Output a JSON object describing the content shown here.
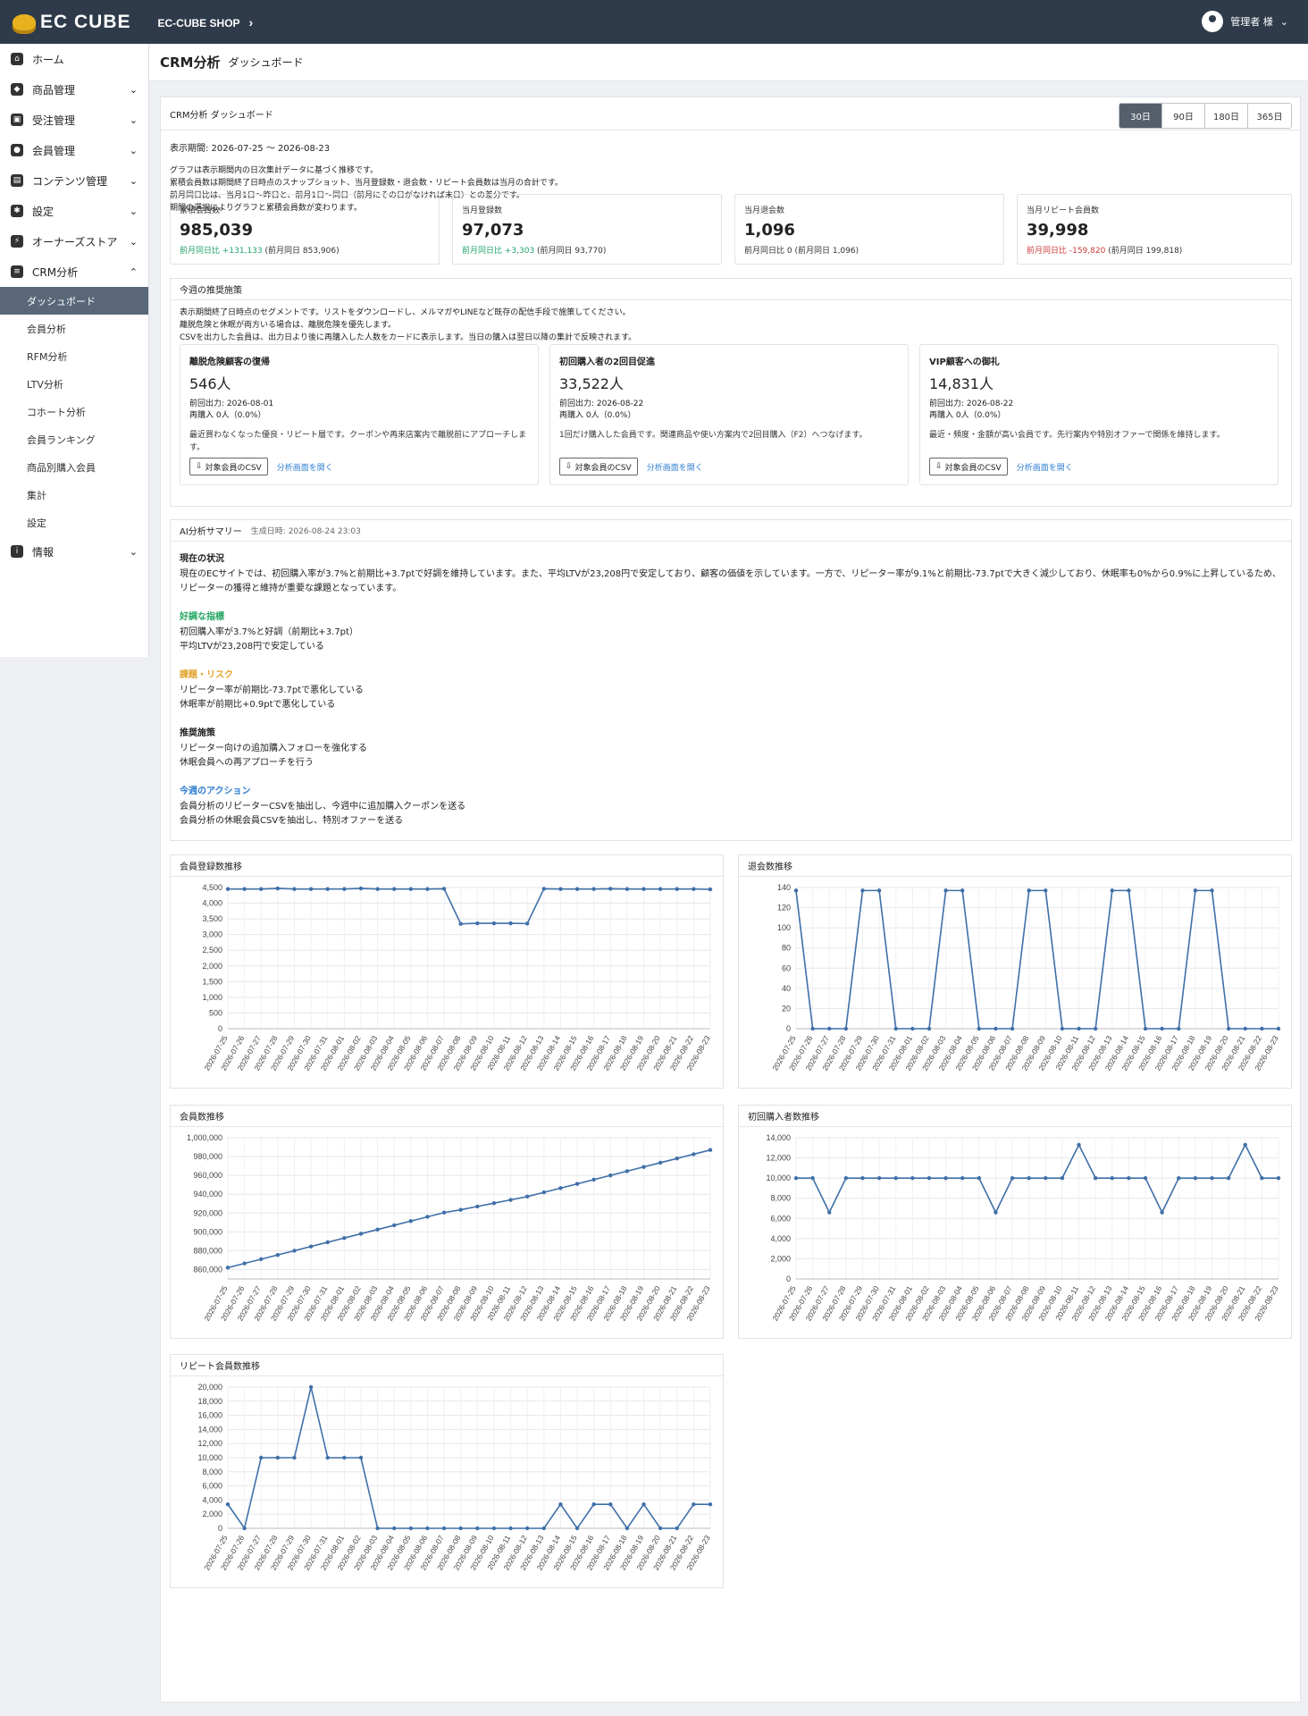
{
  "header": {
    "brand": "EC CUBE",
    "shop": "EC-CUBE SHOP",
    "user": "管理者 様"
  },
  "sidebar": {
    "items": [
      {
        "label": "ホーム",
        "icon": "home-icon",
        "chevron": false
      },
      {
        "label": "商品管理",
        "icon": "cube-icon",
        "chevron": true
      },
      {
        "label": "受注管理",
        "icon": "cart-icon",
        "chevron": true
      },
      {
        "label": "会員管理",
        "icon": "users-icon",
        "chevron": true
      },
      {
        "label": "コンテンツ管理",
        "icon": "file-icon",
        "chevron": true
      },
      {
        "label": "設定",
        "icon": "gear-icon",
        "chevron": true
      },
      {
        "label": "オーナーズストア",
        "icon": "plug-icon",
        "chevron": true
      },
      {
        "label": "CRM分析",
        "icon": "chart-icon",
        "chevron": true
      }
    ],
    "subitems": [
      "ダッシュボード",
      "会員分析",
      "RFM分析",
      "LTV分析",
      "コホート分析",
      "会員ランキング",
      "商品別購入会員",
      "集計",
      "設定"
    ],
    "info": "情報"
  },
  "page": {
    "title": "CRM分析",
    "subtitle": "ダッシュボード"
  },
  "dashboard": {
    "heading": "CRM分析 ダッシュボード",
    "ranges": [
      "30日",
      "90日",
      "180日",
      "365日"
    ],
    "active_range": "30日",
    "period": "表示期間: 2026-07-25 〜 2026-08-23",
    "notes": [
      "グラフは表示期間内の日次集計データに基づく推移です。",
      "累積会員数は期間終了日時点のスナップショット、当月登録数・退会数・リピート会員数は当月の合計です。",
      "前月同日比は、当月1日〜昨日と、前月1日〜同日（前月にその日がなければ末日）との差分です。",
      "期間の選択によりグラフと累積会員数が変わります。"
    ]
  },
  "kpis": [
    {
      "label": "累積会員数",
      "value": "985,039",
      "delta": "前月同日比 +131,133",
      "prev": "(前月同日 853,906)",
      "trend": "up"
    },
    {
      "label": "当月登録数",
      "value": "97,073",
      "delta": "前月同日比 +3,303",
      "prev": "(前月同日 93,770)",
      "trend": "up"
    },
    {
      "label": "当月退会数",
      "value": "1,096",
      "delta": "前月同日比 0",
      "prev": "(前月同日 1,096)",
      "trend": "flat"
    },
    {
      "label": "当月リピート会員数",
      "value": "39,998",
      "delta": "前月同日比 -159,820",
      "prev": "(前月同日 199,818)",
      "trend": "down"
    }
  ],
  "recommend": {
    "title": "今週の推奨施策",
    "notes": [
      "表示期間終了日時点のセグメントです。リストをダウンロードし、メルマガやLINEなど既存の配信手段で施策してください。",
      "離脱危険と休眠が両方いる場合は、離脱危険を優先します。",
      "CSVを出力した会員は、出力日より後に再購入した人数をカードに表示します。当日の購入は翌日以降の集計で反映されます。"
    ],
    "cards": [
      {
        "title": "離脱危険顧客の復帰",
        "count": "546人",
        "output": "前回出力: 2026-08-01",
        "rebuy": "再購入 0人（0.0%）",
        "desc": "最近買わなくなった優良・リピート層です。クーポンや再来店案内で離脱前にアプローチします。",
        "csv": "対象会員のCSV",
        "link": "分析画面を開く"
      },
      {
        "title": "初回購入者の2回目促進",
        "count": "33,522人",
        "output": "前回出力: 2026-08-22",
        "rebuy": "再購入 0人（0.0%）",
        "desc": "1回だけ購入した会員です。関連商品や使い方案内で2回目購入（F2）へつなげます。",
        "csv": "対象会員のCSV",
        "link": "分析画面を開く"
      },
      {
        "title": "VIP顧客への御礼",
        "count": "14,831人",
        "output": "前回出力: 2026-08-22",
        "rebuy": "再購入 0人（0.0%）",
        "desc": "最近・頻度・金額が高い会員です。先行案内や特別オファーで関係を維持します。",
        "csv": "対象会員のCSV",
        "link": "分析画面を開く"
      }
    ]
  },
  "ai": {
    "title": "AI分析サマリー",
    "generated": "生成日時: 2026-08-24 23:03",
    "status_head": "現在の状況",
    "status": "現在のECサイトでは、初回購入率が3.7%と前期比+3.7ptで好調を維持しています。また、平均LTVが23,208円で安定しており、顧客の価値を示しています。一方で、リピーター率が9.1%と前期比-73.7ptで大きく減少しており、休眠率も0%から0.9%に上昇しているため、リピーターの獲得と維持が重要な課題となっています。",
    "good_head": "好調な指標",
    "good": [
      "初回購入率が3.7%と好調（前期比+3.7pt）",
      "平均LTVが23,208円で安定している"
    ],
    "risk_head": "課題・リスク",
    "risk": [
      "リピーター率が前期比-73.7ptで悪化している",
      "休眠率が前期比+0.9ptで悪化している"
    ],
    "rec_head": "推奨施策",
    "rec": [
      "リピーター向けの追加購入フォローを強化する",
      "休眠会員への再アプローチを行う"
    ],
    "action_head": "今週のアクション",
    "action": [
      "会員分析のリピーターCSVを抽出し、今週中に追加購入クーポンを送る",
      "会員分析の休眠会員CSVを抽出し、特別オファーを送る"
    ]
  },
  "chart_data": [
    {
      "type": "line",
      "title": "会員登録数推移",
      "x": [
        "2026-07-25",
        "2026-07-26",
        "2026-07-27",
        "2026-07-28",
        "2026-07-29",
        "2026-07-30",
        "2026-07-31",
        "2026-08-01",
        "2026-08-02",
        "2026-08-03",
        "2026-08-04",
        "2026-08-05",
        "2026-08-06",
        "2026-08-07",
        "2026-08-08",
        "2026-08-09",
        "2026-08-10",
        "2026-08-11",
        "2026-08-12",
        "2026-08-13",
        "2026-08-14",
        "2026-08-15",
        "2026-08-16",
        "2026-08-17",
        "2026-08-18",
        "2026-08-19",
        "2026-08-20",
        "2026-08-21",
        "2026-08-22",
        "2026-08-23"
      ],
      "values": [
        4450,
        4450,
        4450,
        4470,
        4450,
        4450,
        4450,
        4450,
        4470,
        4450,
        4450,
        4450,
        4450,
        4460,
        3340,
        3360,
        3360,
        3360,
        3350,
        4460,
        4450,
        4450,
        4450,
        4460,
        4450,
        4450,
        4450,
        4450,
        4450,
        4440
      ],
      "ylim": [
        0,
        4500
      ],
      "ticks": [
        0,
        500,
        1000,
        1500,
        2000,
        2500,
        3000,
        3500,
        4000,
        4500
      ],
      "tick_labels": [
        "0",
        "500",
        "1,000",
        "1,500",
        "2,000",
        "2,500",
        "3,000",
        "3,500",
        "4,000",
        "4,500"
      ]
    },
    {
      "type": "line",
      "title": "退会数推移",
      "x": [
        "2026-07-25",
        "2026-07-26",
        "2026-07-27",
        "2026-07-28",
        "2026-07-29",
        "2026-07-30",
        "2026-07-31",
        "2026-08-01",
        "2026-08-02",
        "2026-08-03",
        "2026-08-04",
        "2026-08-05",
        "2026-08-06",
        "2026-08-07",
        "2026-08-08",
        "2026-08-09",
        "2026-08-10",
        "2026-08-11",
        "2026-08-12",
        "2026-08-13",
        "2026-08-14",
        "2026-08-15",
        "2026-08-16",
        "2026-08-17",
        "2026-08-18",
        "2026-08-19",
        "2026-08-20",
        "2026-08-21",
        "2026-08-22",
        "2026-08-23"
      ],
      "values": [
        137,
        0,
        0,
        0,
        137,
        137,
        0,
        0,
        0,
        137,
        137,
        0,
        0,
        0,
        137,
        137,
        0,
        0,
        0,
        137,
        137,
        0,
        0,
        0,
        137,
        137,
        0,
        0,
        0,
        0
      ],
      "ylim": [
        0,
        140
      ],
      "ticks": [
        0,
        20,
        40,
        60,
        80,
        100,
        120,
        140
      ],
      "tick_labels": [
        "0",
        "20",
        "40",
        "60",
        "80",
        "100",
        "120",
        "140"
      ]
    },
    {
      "type": "line",
      "title": "会員数推移",
      "x": [
        "2026-07-25",
        "2026-07-26",
        "2026-07-27",
        "2026-07-28",
        "2026-07-29",
        "2026-07-30",
        "2026-07-31",
        "2026-08-01",
        "2026-08-02",
        "2026-08-03",
        "2026-08-04",
        "2026-08-05",
        "2026-08-06",
        "2026-08-07",
        "2026-08-08",
        "2026-08-09",
        "2026-08-10",
        "2026-08-11",
        "2026-08-12",
        "2026-08-13",
        "2026-08-14",
        "2026-08-15",
        "2026-08-16",
        "2026-08-17",
        "2026-08-18",
        "2026-08-19",
        "2026-08-20",
        "2026-08-21",
        "2026-08-22",
        "2026-08-23"
      ],
      "values": [
        862000,
        866500,
        871000,
        875500,
        880000,
        884500,
        889000,
        893500,
        898000,
        902500,
        907000,
        911500,
        916000,
        920500,
        923500,
        927000,
        930500,
        934000,
        937500,
        942000,
        946500,
        951000,
        955500,
        960000,
        964500,
        969000,
        973500,
        978000,
        982500,
        987000
      ],
      "ylim": [
        850000,
        1000000
      ],
      "ticks": [
        860000,
        880000,
        900000,
        920000,
        940000,
        960000,
        980000,
        1000000
      ],
      "tick_labels": [
        "860,000",
        "880,000",
        "900,000",
        "920,000",
        "940,000",
        "960,000",
        "980,000",
        "1,000,000"
      ]
    },
    {
      "type": "line",
      "title": "初回購入者数推移",
      "x": [
        "2026-07-25",
        "2026-07-26",
        "2026-07-27",
        "2026-07-28",
        "2026-07-29",
        "2026-07-30",
        "2026-07-31",
        "2026-08-01",
        "2026-08-02",
        "2026-08-03",
        "2026-08-04",
        "2026-08-05",
        "2026-08-06",
        "2026-08-07",
        "2026-08-08",
        "2026-08-09",
        "2026-08-10",
        "2026-08-11",
        "2026-08-12",
        "2026-08-13",
        "2026-08-14",
        "2026-08-15",
        "2026-08-16",
        "2026-08-17",
        "2026-08-18",
        "2026-08-19",
        "2026-08-20",
        "2026-08-21",
        "2026-08-22",
        "2026-08-23"
      ],
      "values": [
        10000,
        10000,
        6600,
        10000,
        10000,
        10000,
        10000,
        10000,
        10000,
        10000,
        10000,
        10000,
        6600,
        10000,
        10000,
        10000,
        10000,
        13300,
        10000,
        10000,
        10000,
        10000,
        6600,
        10000,
        10000,
        10000,
        10000,
        13300,
        10000,
        10000
      ],
      "ylim": [
        0,
        14000
      ],
      "ticks": [
        0,
        2000,
        4000,
        6000,
        8000,
        10000,
        12000,
        14000
      ],
      "tick_labels": [
        "0",
        "2,000",
        "4,000",
        "6,000",
        "8,000",
        "10,000",
        "12,000",
        "14,000"
      ]
    },
    {
      "type": "line",
      "title": "リピート会員数推移",
      "x": [
        "2026-07-25",
        "2026-07-26",
        "2026-07-27",
        "2026-07-28",
        "2026-07-29",
        "2026-07-30",
        "2026-07-31",
        "2026-08-01",
        "2026-08-02",
        "2026-08-03",
        "2026-08-04",
        "2026-08-05",
        "2026-08-06",
        "2026-08-07",
        "2026-08-08",
        "2026-08-09",
        "2026-08-10",
        "2026-08-11",
        "2026-08-12",
        "2026-08-13",
        "2026-08-14",
        "2026-08-15",
        "2026-08-16",
        "2026-08-17",
        "2026-08-18",
        "2026-08-19",
        "2026-08-20",
        "2026-08-21",
        "2026-08-22",
        "2026-08-23"
      ],
      "values": [
        3400,
        0,
        10000,
        10000,
        10000,
        20000,
        10000,
        10000,
        10000,
        0,
        0,
        0,
        0,
        0,
        0,
        0,
        0,
        0,
        0,
        0,
        3400,
        0,
        3400,
        3400,
        0,
        3400,
        0,
        0,
        3400,
        3400
      ],
      "ylim": [
        0,
        20000
      ],
      "ticks": [
        0,
        2000,
        4000,
        6000,
        8000,
        10000,
        12000,
        14000,
        16000,
        18000,
        20000
      ],
      "tick_labels": [
        "0",
        "2,000",
        "4,000",
        "6,000",
        "8,000",
        "10,000",
        "12,000",
        "14,000",
        "16,000",
        "18,000",
        "20,000"
      ]
    }
  ],
  "colors": {
    "accent": "#3f6fa8",
    "header": "#2f3b4a",
    "positive": "#21a36b",
    "negative": "#cc3b3b"
  }
}
